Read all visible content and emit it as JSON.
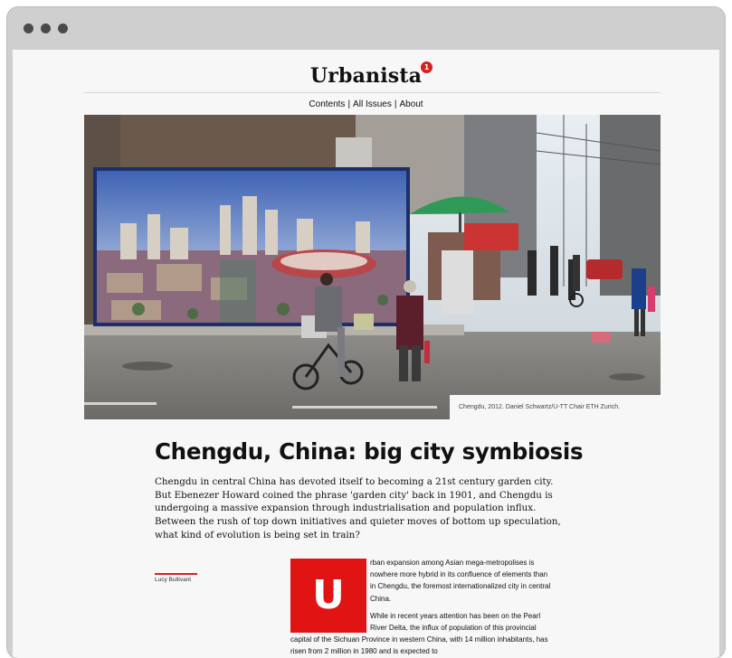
{
  "site": {
    "logo": "Urbanista",
    "badge_count": "1",
    "nav": {
      "contents": "Contents",
      "all_issues": "All Issues",
      "about": "About",
      "separator": "|"
    }
  },
  "hero": {
    "caption": "Chengdu, 2012. Daniel Schwartz/U-TT Chair ETH Zurich."
  },
  "article": {
    "title": "Chengdu, China: big city symbiosis",
    "intro": "Chengdu in central China has devoted itself to becoming a 21st century garden city. But Ebenezer Howard coined the phrase 'garden city' back in 1901, and Chengdu is undergoing a massive expansion through industrialisation and population influx. Between the rush of top down initiatives and quieter moves of bottom up speculation, what kind of evolution is being set in train?",
    "author": "Lucy Bullivant",
    "dropcap": "U",
    "paragraph_1": "rban expansion among Asian mega-metropolises is nowhere more hybrid in its confluence of elements than in Chengdu, the foremost internationalized city in central China.",
    "paragraph_2": "While in recent years attention has been on the Pearl River Delta, the influx of population of this provincial capital of the Sichuan Province in western China, with 14 million inhabitants, has risen from 2 million in 1980 and is expected to"
  },
  "colors": {
    "accent": "#e11414",
    "badge": "#d61f1f",
    "page_background": "#f7f7f7",
    "window_frame": "#cfcfcf"
  }
}
